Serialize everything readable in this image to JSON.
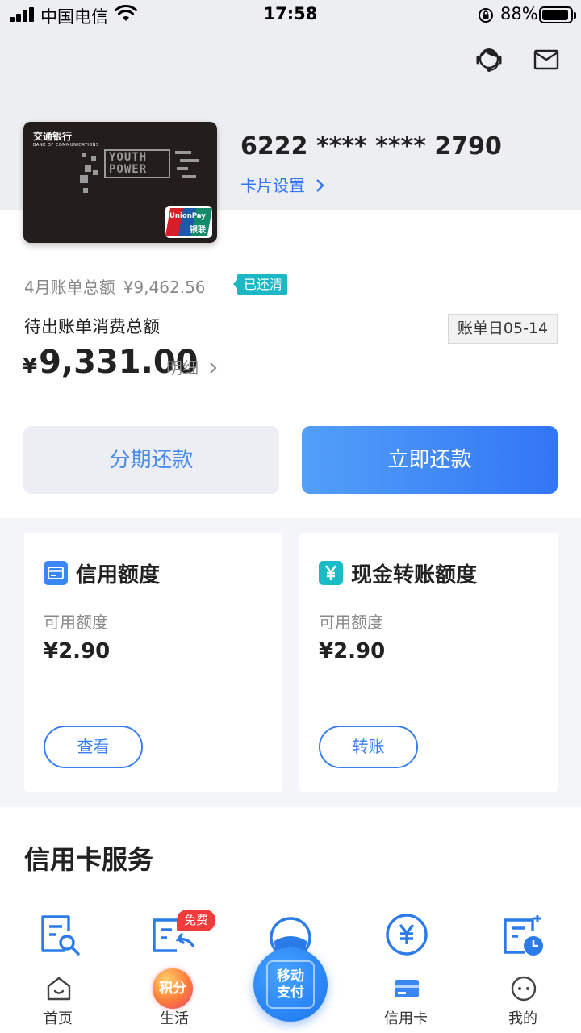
{
  "status_bar": {
    "carrier": "中国电信",
    "time": "17:58",
    "battery_pct": "88%"
  },
  "header": {
    "icons": [
      "customer-service-icon",
      "mail-icon"
    ]
  },
  "card": {
    "bank_name": "交通银行",
    "bank_name_en": "BANK OF COMMUNICATIONS",
    "card_art_text": "YOUTH POWER",
    "network_logo_en": "UnionPay",
    "network_logo_cn": "银联",
    "number": "6222 **** **** 2790",
    "settings_label": "卡片设置"
  },
  "bill": {
    "last_label": "4月账单总额",
    "last_amount": "¥9,462.56",
    "paid_tag": "已还清",
    "pending_label": "待出账单消费总额",
    "bill_day": "账单日05-14",
    "currency": "¥",
    "amount": "9,331.00",
    "detail_label": "明细"
  },
  "actions": {
    "installment": "分期还款",
    "repay_now": "立即还款"
  },
  "panels": [
    {
      "title": "信用额度",
      "icon": "credit-limit-icon",
      "available_label": "可用额度",
      "available_value": "¥2.90",
      "button": "查看"
    },
    {
      "title": "现金转账额度",
      "icon": "yuan-icon",
      "available_label": "可用额度",
      "available_value": "¥2.90",
      "button": "转账"
    }
  ],
  "services": {
    "title": "信用卡服务",
    "free_badge": "免费",
    "icons": [
      "bill-search-icon",
      "bill-return-icon",
      "service-avatar-icon",
      "yuan-circle-icon",
      "bill-clock-icon"
    ]
  },
  "tabbar": {
    "home": "首页",
    "life": "生活",
    "points_badge": "积分",
    "pay": "移动\n支付",
    "pay_line1": "移动",
    "pay_line2": "支付",
    "credit_card": "信用卡",
    "mine": "我的"
  },
  "colors": {
    "accent": "#3477f5",
    "paid_tag": "#1cb8c6",
    "free_badge": "#f23b3b"
  }
}
